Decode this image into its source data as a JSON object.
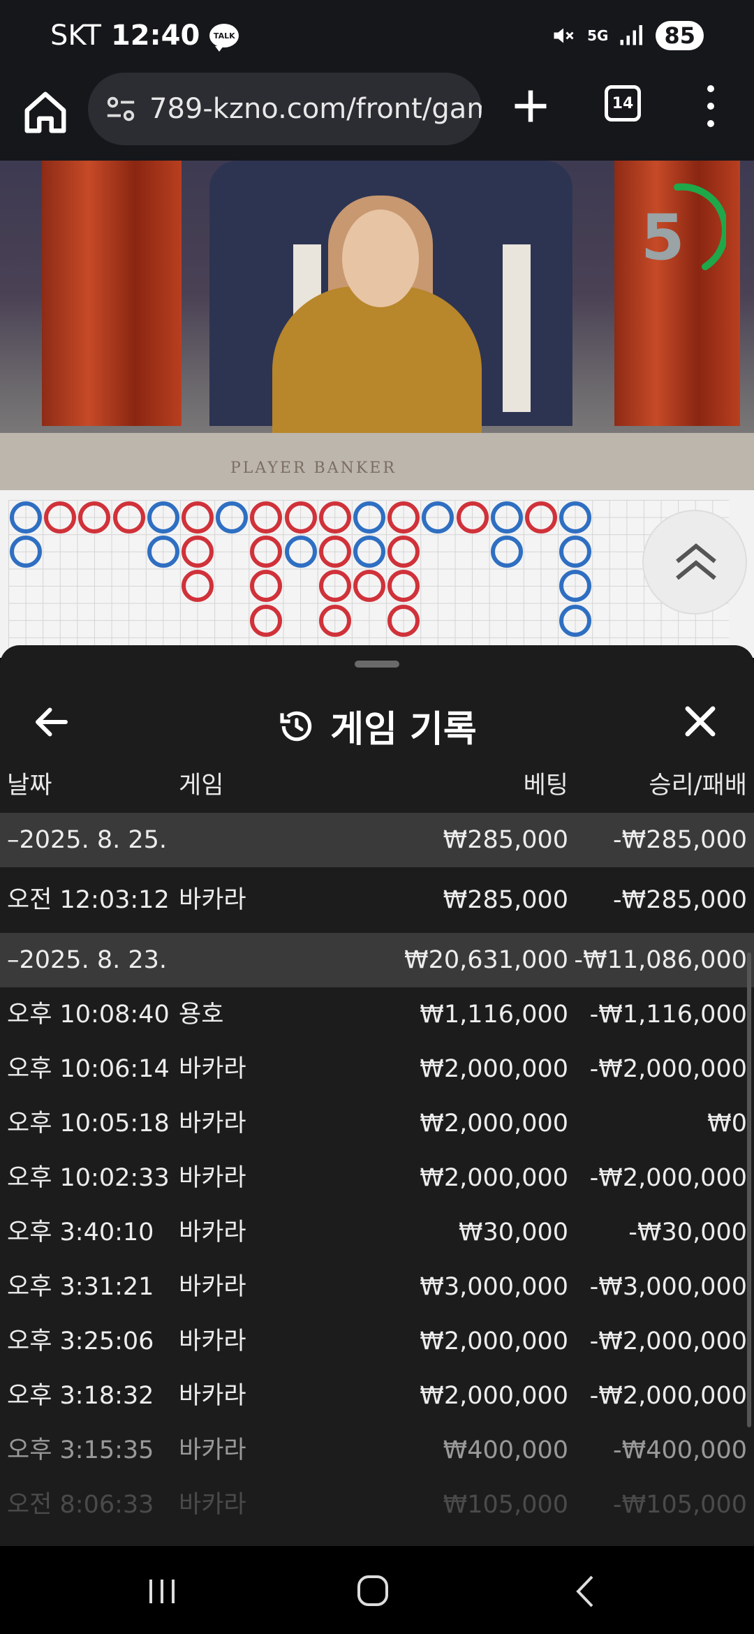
{
  "status_bar": {
    "carrier": "SKT",
    "time": "12:40",
    "talk_badge": "TALK",
    "network": "5G",
    "battery": "85",
    "icons": [
      "talk-icon",
      "mute-icon",
      "5g-icon",
      "signal-icon",
      "battery-icon"
    ]
  },
  "browser": {
    "url": "789-kzno.com/front/gam",
    "tab_count": "14",
    "icons": [
      "home-icon",
      "site-info-icon",
      "plus-icon",
      "tabs-icon",
      "more-vert-icon"
    ]
  },
  "video": {
    "countdown": "5",
    "table_text": "PLAYER   BANKER"
  },
  "roadmap": {
    "colors": {
      "player": "#2f6fc2",
      "banker": "#d0323a",
      "tie": "#2e8b3e"
    },
    "columns": [
      [
        "P",
        "P"
      ],
      [
        "B"
      ],
      [
        "B"
      ],
      [
        "B"
      ],
      [
        "P",
        "P"
      ],
      [
        "B",
        "B",
        "B"
      ],
      [
        "P"
      ],
      [
        "B",
        "B",
        "B",
        "B"
      ],
      [
        "B",
        "P"
      ],
      [
        "B",
        "B",
        "B",
        "B"
      ],
      [
        "P",
        "P",
        "B"
      ],
      [
        "B",
        "B",
        "B",
        "B"
      ],
      [
        "P"
      ],
      [
        "B"
      ],
      [
        "P",
        "P"
      ],
      [
        "B"
      ],
      [
        "P",
        "P",
        "P",
        "P"
      ]
    ]
  },
  "sheet": {
    "title": "게임 기록",
    "icons": [
      "back-arrow-icon",
      "history-icon",
      "close-icon"
    ],
    "columns": {
      "date": "날짜",
      "game": "게임",
      "bet": "베팅",
      "result": "승리/패배"
    },
    "rows": [
      {
        "type": "group",
        "date": "–2025. 8. 25.",
        "game": "",
        "bet": "₩285,000",
        "result": "-₩285,000"
      },
      {
        "type": "item",
        "date": "오전 12:03:12",
        "game": "바카라",
        "bet": "₩285,000",
        "result": "-₩285,000"
      },
      {
        "type": "group",
        "date": "–2025. 8. 23.",
        "game": "",
        "bet": "₩20,631,000",
        "result": "-₩11,086,000"
      },
      {
        "type": "item",
        "date": "오후 10:08:40",
        "game": "용호",
        "bet": "₩1,116,000",
        "result": "-₩1,116,000"
      },
      {
        "type": "item",
        "date": "오후 10:06:14",
        "game": "바카라",
        "bet": "₩2,000,000",
        "result": "-₩2,000,000"
      },
      {
        "type": "item",
        "date": "오후 10:05:18",
        "game": "바카라",
        "bet": "₩2,000,000",
        "result": "₩0"
      },
      {
        "type": "item",
        "date": "오후 10:02:33",
        "game": "바카라",
        "bet": "₩2,000,000",
        "result": "-₩2,000,000"
      },
      {
        "type": "item",
        "date": "오후 3:40:10",
        "game": "바카라",
        "bet": "₩30,000",
        "result": "-₩30,000"
      },
      {
        "type": "item",
        "date": "오후 3:31:21",
        "game": "바카라",
        "bet": "₩3,000,000",
        "result": "-₩3,000,000"
      },
      {
        "type": "item",
        "date": "오후 3:25:06",
        "game": "바카라",
        "bet": "₩2,000,000",
        "result": "-₩2,000,000"
      },
      {
        "type": "item",
        "date": "오후 3:18:32",
        "game": "바카라",
        "bet": "₩2,000,000",
        "result": "-₩2,000,000"
      },
      {
        "type": "item",
        "date": "오후 3:15:35",
        "game": "바카라",
        "bet": "₩400,000",
        "result": "-₩400,000"
      },
      {
        "type": "item",
        "date": "오전 8:06:33",
        "game": "바카라",
        "bet": "₩105,000",
        "result": "-₩105,000"
      }
    ]
  },
  "nav": {
    "icons": [
      "recents-icon",
      "home-circle-icon",
      "back-chevron-icon"
    ]
  }
}
